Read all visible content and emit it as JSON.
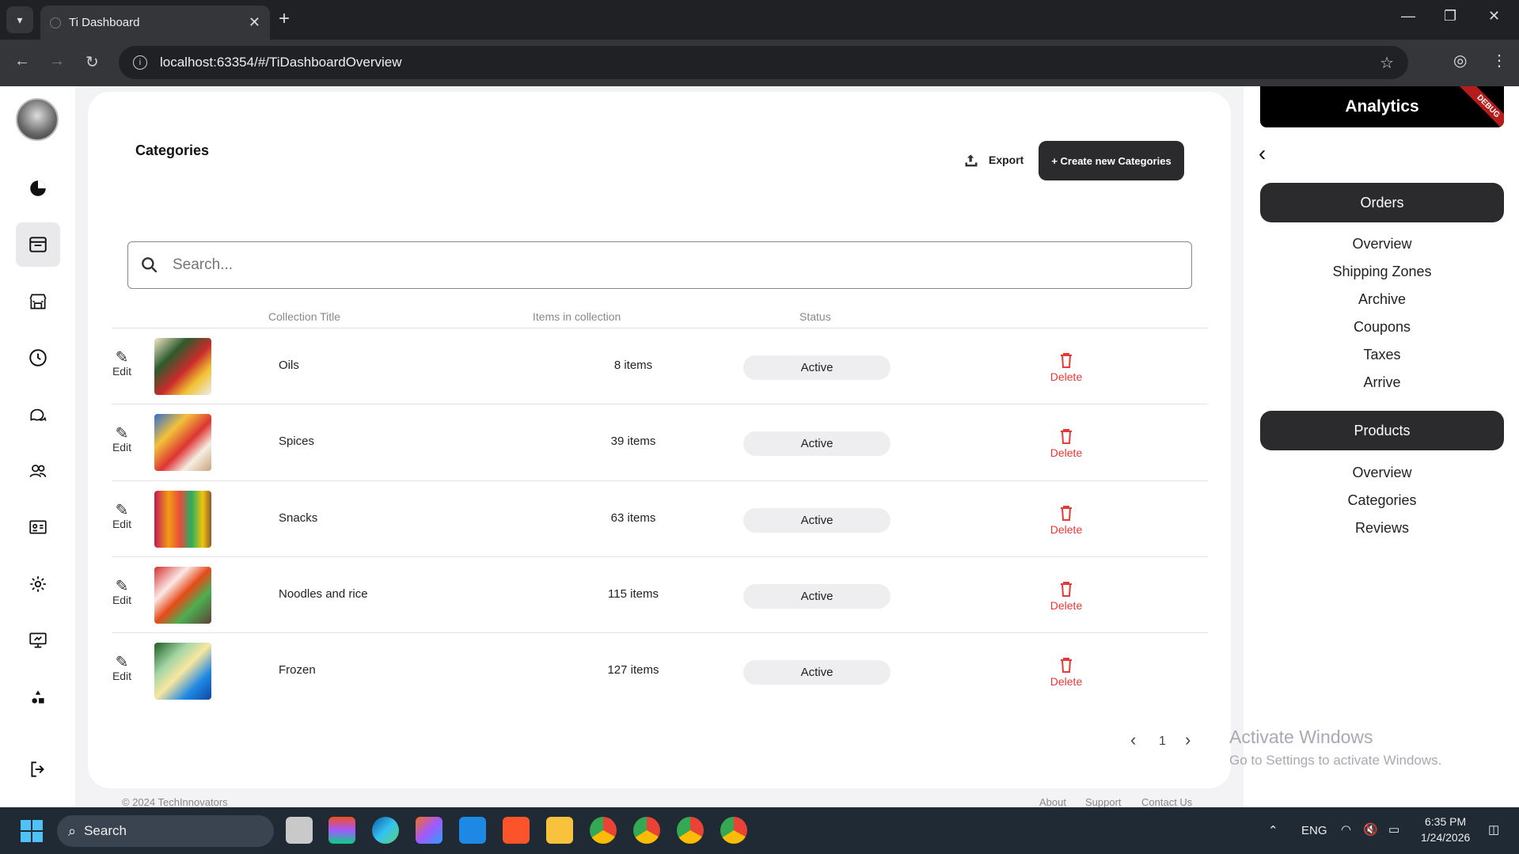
{
  "browser": {
    "tab_title": "Ti Dashboard",
    "url": "localhost:63354/#/TiDashboardOverview",
    "new_tab": "+",
    "close_tab": "✕"
  },
  "sidebar": {
    "items": [
      {
        "name": "analytics",
        "icon": "pie-chart-icon"
      },
      {
        "name": "inbox",
        "icon": "inbox-icon",
        "active": true
      },
      {
        "name": "store",
        "icon": "store-icon"
      },
      {
        "name": "history",
        "icon": "clock-icon"
      },
      {
        "name": "chat",
        "icon": "chat-icon"
      },
      {
        "name": "users",
        "icon": "users-icon"
      },
      {
        "name": "contacts",
        "icon": "id-card-icon"
      },
      {
        "name": "settings",
        "icon": "gear-icon"
      },
      {
        "name": "display",
        "icon": "monitor-icon"
      },
      {
        "name": "apps",
        "icon": "shapes-icon"
      },
      {
        "name": "logout",
        "icon": "logout-icon"
      }
    ]
  },
  "main": {
    "title": "Categories",
    "export_label": "Export",
    "create_label": "+ Create new Categories",
    "search_placeholder": "Search...",
    "columns": {
      "title": "Collection Title",
      "items": "Items in collection",
      "status": "Status"
    },
    "edit_label": "Edit",
    "delete_label": "Delete",
    "rows": [
      {
        "title": "Oils",
        "items": "8 items",
        "status": "Active"
      },
      {
        "title": "Spices",
        "items": "39 items",
        "status": "Active"
      },
      {
        "title": "Snacks",
        "items": "63 items",
        "status": "Active"
      },
      {
        "title": "Noodles and rice",
        "items": "115 items",
        "status": "Active"
      },
      {
        "title": "Frozen",
        "items": "127 items",
        "status": "Active"
      }
    ],
    "pagination": {
      "prev": "‹",
      "page": "1",
      "next": "›"
    },
    "footer": {
      "copyright": "© 2024 TechInnovators",
      "links": [
        "About",
        "Support",
        "Contact Us"
      ]
    }
  },
  "right_panel": {
    "header": "Analytics",
    "debug_label": "DEBUG",
    "groups": [
      {
        "label": "Orders",
        "items": [
          "Overview",
          "Shipping Zones",
          "Archive",
          "Coupons",
          "Taxes",
          "Arrive"
        ]
      },
      {
        "label": "Products",
        "items": [
          "Overview",
          "Categories",
          "Reviews"
        ]
      }
    ]
  },
  "watermark": {
    "line1": "Activate Windows",
    "line2": "Go to Settings to activate Windows."
  },
  "taskbar": {
    "search_label": "Search",
    "lang": "ENG",
    "time": "6:35 PM",
    "date": "1/24/2026"
  },
  "colors": {
    "accent_dark": "#2b2b2e",
    "delete_red": "#e53935",
    "badge_bg": "#eeeef0"
  }
}
